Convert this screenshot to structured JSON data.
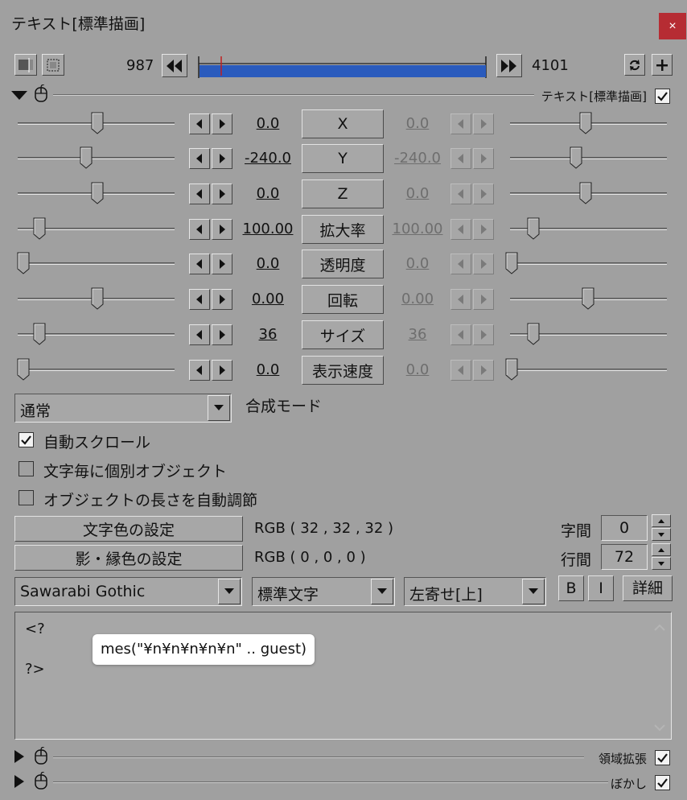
{
  "window": {
    "title": "テキスト[標準描画]",
    "close_glyph": "×"
  },
  "timeline": {
    "start_frame": "987",
    "end_frame": "4101",
    "bar_color": "#2a5bbd"
  },
  "object_section": {
    "label": "テキスト[標準描画]",
    "enabled": true
  },
  "params": [
    {
      "name": "X",
      "left": "0.0",
      "right": "0.0"
    },
    {
      "name": "Y",
      "left": "-240.0",
      "right": "-240.0"
    },
    {
      "name": "Z",
      "left": "0.0",
      "right": "0.0"
    },
    {
      "name": "拡大率",
      "left": "100.00",
      "right": "100.00"
    },
    {
      "name": "透明度",
      "left": "0.0",
      "right": "0.0"
    },
    {
      "name": "回転",
      "left": "0.00",
      "right": "0.00"
    },
    {
      "name": "サイズ",
      "left": "36",
      "right": "36"
    },
    {
      "name": "表示速度",
      "left": "0.0",
      "right": "0.0"
    }
  ],
  "blend": {
    "value": "通常",
    "label": "合成モード"
  },
  "options": [
    {
      "label": "自動スクロール",
      "checked": true
    },
    {
      "label": "文字毎に個別オブジェクト",
      "checked": false
    },
    {
      "label": "オブジェクトの長さを自動調節",
      "checked": false
    }
  ],
  "colors": {
    "text_button": "文字色の設定",
    "text_rgb": "RGB ( 32 , 32 , 32 )",
    "shadow_button": "影・縁色の設定",
    "shadow_rgb": "RGB ( 0 , 0 , 0 )"
  },
  "spacing": {
    "char_label": "字間",
    "char_value": "0",
    "line_label": "行間",
    "line_value": "72"
  },
  "font": {
    "family": "Sawarabi Gothic",
    "style": "標準文字",
    "align": "左寄せ[上]",
    "bold": "B",
    "italic": "I",
    "detail": "詳細"
  },
  "text_content": {
    "line1": "<?",
    "line2": "mes(\"¥n¥n¥n¥n¥n\" .. guest)",
    "line3": "?>"
  },
  "filters": [
    {
      "label": "領域拡張",
      "enabled": true
    },
    {
      "label": "ぼかし",
      "enabled": true
    }
  ]
}
